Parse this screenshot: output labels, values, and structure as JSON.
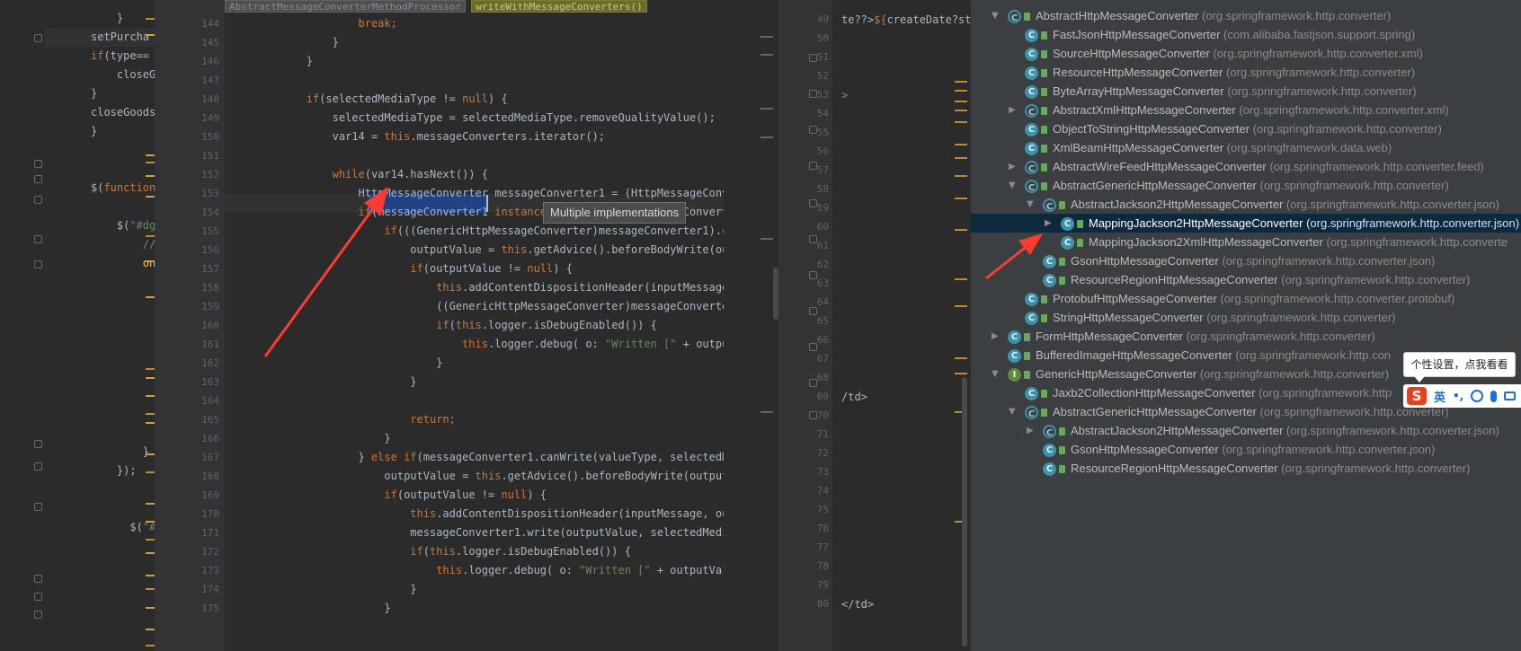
{
  "breadcrumb": [
    "AbstractMessageConverterMethodProcessor",
    "writeWithMessageConverters()"
  ],
  "tooltip": "Multiple implementations",
  "left_code": [
    {
      "parts": [
        [
          "",
          "    "
        ],
        [
          "",
          "}"
        ]
      ]
    },
    {
      "parts": [
        [
          "",
          "setPurcha"
        ]
      ]
    },
    {
      "parts": [
        [
          "kw",
          "if"
        ],
        [
          "",
          "(type=="
        ]
      ]
    },
    {
      "parts": [
        [
          "",
          "    closeG"
        ]
      ]
    },
    {
      "parts": [
        [
          "",
          "}"
        ]
      ]
    },
    {
      "parts": [
        [
          "",
          "closeGoodsC"
        ]
      ]
    },
    {
      "parts": [
        [
          "",
          "}"
        ]
      ]
    },
    {
      "parts": [
        [
          "",
          ""
        ]
      ]
    },
    {
      "parts": [
        [
          "",
          ""
        ]
      ]
    },
    {
      "parts": [
        [
          "",
          "$("
        ],
        [
          "kw",
          "function"
        ],
        [
          "",
          " ("
        ]
      ]
    },
    {
      "parts": [
        [
          "",
          ""
        ]
      ]
    },
    {
      "parts": [
        [
          "",
          "    $("
        ],
        [
          "str",
          "\"#dg\""
        ],
        [
          "",
          ").da"
        ]
      ]
    },
    {
      "parts": [
        [
          "cm",
          "        //双击事"
        ]
      ]
    },
    {
      "parts": [
        [
          "fn",
          "        onDblCl"
        ]
      ]
    },
    {
      "parts": [
        [
          "",
          "            $("
        ]
      ]
    },
    {
      "parts": [
        [
          "",
          "            $("
        ]
      ]
    },
    {
      "parts": [
        [
          "",
          "            $("
        ]
      ]
    },
    {
      "parts": [
        [
          "",
          "            $("
        ]
      ]
    },
    {
      "parts": [
        [
          "",
          "            $("
        ]
      ]
    },
    {
      "parts": [
        [
          "",
          "            $("
        ]
      ]
    },
    {
      "parts": [
        [
          "",
          "            $("
        ]
      ]
    },
    {
      "parts": [
        [
          "",
          "            $("
        ]
      ]
    },
    {
      "parts": [
        [
          "",
          "            $("
        ]
      ]
    },
    {
      "parts": [
        [
          "",
          "        }"
        ]
      ]
    },
    {
      "parts": [
        [
          "",
          "    });"
        ]
      ]
    },
    {
      "parts": [
        [
          "",
          ""
        ]
      ]
    },
    {
      "parts": [
        [
          "",
          ""
        ]
      ]
    },
    {
      "parts": [
        [
          "",
          "      $("
        ],
        [
          "str",
          "\"#dg3\""
        ],
        [
          "",
          ")."
        ]
      ]
    },
    {
      "parts": [
        [
          "cm",
          "            //双"
        ]
      ]
    },
    {
      "parts": [
        [
          "fn",
          "            onD"
        ]
      ]
    }
  ],
  "main_code": [
    {
      "num": "144",
      "parts": [
        [
          "kw",
          "                    break;"
        ]
      ]
    },
    {
      "num": "145",
      "parts": [
        [
          "",
          "                }"
        ]
      ]
    },
    {
      "num": "146",
      "parts": [
        [
          "",
          "            }"
        ]
      ]
    },
    {
      "num": "147",
      "parts": [
        [
          "",
          ""
        ]
      ]
    },
    {
      "num": "148",
      "parts": [
        [
          "kw",
          "            if"
        ],
        [
          "",
          "(selectedMediaType != "
        ],
        [
          "kw",
          "null"
        ],
        [
          "",
          ") {"
        ]
      ]
    },
    {
      "num": "149",
      "parts": [
        [
          "",
          "                selectedMediaType = selectedMediaType.removeQualityValue();"
        ]
      ]
    },
    {
      "num": "150",
      "parts": [
        [
          "",
          "                var14 = "
        ],
        [
          "kw",
          "this"
        ],
        [
          "",
          ".messageConverters.iterator();"
        ]
      ]
    },
    {
      "num": "151",
      "parts": [
        [
          "",
          ""
        ]
      ]
    },
    {
      "num": "152",
      "parts": [
        [
          "kw",
          "                while"
        ],
        [
          "",
          "(var14.hasNext()) {"
        ]
      ]
    },
    {
      "num": "153",
      "parts": [
        [
          "",
          "                    HttpMessageConverter messageConverter1 = (HttpMessageConverter)var14.next();"
        ]
      ]
    },
    {
      "num": "154",
      "parts": [
        [
          "kw",
          "                    if"
        ],
        [
          "",
          "(messageConverter1 "
        ],
        [
          "kw",
          "instanceof"
        ],
        [
          "",
          " GenericHttpMessageConverter) {"
        ]
      ]
    },
    {
      "num": "155",
      "parts": [
        [
          "kw",
          "                        if"
        ],
        [
          "",
          "(((GenericHttpMessageConverter)messageConverter1).canWrite"
        ]
      ]
    },
    {
      "num": "156",
      "parts": [
        [
          "",
          "                            outputValue = "
        ],
        [
          "kw",
          "this"
        ],
        [
          "",
          ".getAdvice().beforeBodyWrite(outputValue"
        ]
      ]
    },
    {
      "num": "157",
      "parts": [
        [
          "kw",
          "                            if"
        ],
        [
          "",
          "(outputValue != "
        ],
        [
          "kw",
          "null"
        ],
        [
          "",
          ") {"
        ]
      ]
    },
    {
      "num": "158",
      "parts": [
        [
          "kw",
          "                                this"
        ],
        [
          "",
          ".addContentDispositionHeader(inputMessage, output"
        ]
      ]
    },
    {
      "num": "159",
      "parts": [
        [
          "",
          "                                ((GenericHttpMessageConverter)messageConverter1).write"
        ]
      ]
    },
    {
      "num": "160",
      "parts": [
        [
          "kw",
          "                                if"
        ],
        [
          "",
          "("
        ],
        [
          "kw",
          "this"
        ],
        [
          "",
          ".logger.isDebugEnabled()) {"
        ]
      ]
    },
    {
      "num": "161",
      "parts": [
        [
          "kw",
          "                                    this"
        ],
        [
          "",
          ".logger.debug( o: "
        ],
        [
          "str",
          "\"Written [\""
        ],
        [
          "",
          " + outputValue"
        ]
      ]
    },
    {
      "num": "162",
      "parts": [
        [
          "",
          "                                }"
        ]
      ]
    },
    {
      "num": "163",
      "parts": [
        [
          "",
          "                            }"
        ]
      ]
    },
    {
      "num": "164",
      "parts": [
        [
          "",
          ""
        ]
      ]
    },
    {
      "num": "165",
      "parts": [
        [
          "kw",
          "                            return;"
        ]
      ]
    },
    {
      "num": "166",
      "parts": [
        [
          "",
          "                        }"
        ]
      ]
    },
    {
      "num": "167",
      "parts": [
        [
          "",
          "                    } "
        ],
        [
          "kw",
          "else if"
        ],
        [
          "",
          "(messageConverter1.canWrite(valueType, selectedMediaType"
        ]
      ]
    },
    {
      "num": "168",
      "parts": [
        [
          "",
          "                        outputValue = "
        ],
        [
          "kw",
          "this"
        ],
        [
          "",
          ".getAdvice().beforeBodyWrite(outputValue,"
        ]
      ]
    },
    {
      "num": "169",
      "parts": [
        [
          "kw",
          "                        if"
        ],
        [
          "",
          "(outputValue != "
        ],
        [
          "kw",
          "null"
        ],
        [
          "",
          ") {"
        ]
      ]
    },
    {
      "num": "170",
      "parts": [
        [
          "kw",
          "                            this"
        ],
        [
          "",
          ".addContentDispositionHeader(inputMessage, outputMe"
        ]
      ]
    },
    {
      "num": "171",
      "parts": [
        [
          "",
          "                            messageConverter1.write(outputValue, selectedMediaType,"
        ]
      ]
    },
    {
      "num": "172",
      "parts": [
        [
          "kw",
          "                            if"
        ],
        [
          "",
          "("
        ],
        [
          "kw",
          "this"
        ],
        [
          "",
          ".logger.isDebugEnabled()) {"
        ]
      ]
    },
    {
      "num": "173",
      "parts": [
        [
          "kw",
          "                                this"
        ],
        [
          "",
          ".logger.debug( o: "
        ],
        [
          "str",
          "\"Written [\""
        ],
        [
          "",
          " + outputValue + \""
        ]
      ]
    },
    {
      "num": "174",
      "parts": [
        [
          "",
          "                            }"
        ]
      ]
    },
    {
      "num": "175",
      "parts": [
        [
          "",
          "                        }"
        ]
      ]
    }
  ],
  "jsp_lines": [
    "49",
    "50",
    "51",
    "52",
    "53",
    "54",
    "55",
    "56",
    "57",
    "58",
    "59",
    "60",
    "61",
    "62",
    "63",
    "64",
    "65",
    "66",
    "67",
    "68",
    "69",
    "70",
    "71",
    "72",
    "73",
    "74",
    "75",
    "76",
    "77",
    "78",
    "79",
    "80"
  ],
  "jsp_code": {
    "0": [
      [
        "",
        "te??>"
      ],
      [
        "kw",
        "${"
      ],
      [
        "",
        "createDate?st"
      ]
    ],
    "4": [
      [
        "kw",
        ">"
      ]
    ],
    "20": [
      [
        "",
        "/td>"
      ]
    ],
    "31": [
      [
        "",
        "</td>"
      ]
    ]
  },
  "tree": [
    {
      "level": 0,
      "arrow": "down",
      "icon": "abs",
      "name": "AbstractHttpMessageConverter",
      "pkg": "(org.springframework.http.converter)"
    },
    {
      "level": 1,
      "arrow": "",
      "icon": "class",
      "name": "FastJsonHttpMessageConverter",
      "pkg": "(com.alibaba.fastjson.support.spring)"
    },
    {
      "level": 1,
      "arrow": "",
      "icon": "class",
      "name": "SourceHttpMessageConverter",
      "pkg": "(org.springframework.http.converter.xml)"
    },
    {
      "level": 1,
      "arrow": "",
      "icon": "class",
      "name": "ResourceHttpMessageConverter",
      "pkg": "(org.springframework.http.converter)"
    },
    {
      "level": 1,
      "arrow": "",
      "icon": "class",
      "name": "ByteArrayHttpMessageConverter",
      "pkg": "(org.springframework.http.converter)"
    },
    {
      "level": 1,
      "arrow": "right",
      "icon": "abs",
      "name": "AbstractXmlHttpMessageConverter",
      "pkg": "(org.springframework.http.converter.xml)"
    },
    {
      "level": 1,
      "arrow": "",
      "icon": "class",
      "name": "ObjectToStringHttpMessageConverter",
      "pkg": "(org.springframework.http.converter)"
    },
    {
      "level": 1,
      "arrow": "",
      "icon": "class",
      "name": "XmlBeamHttpMessageConverter",
      "pkg": "(org.springframework.data.web)"
    },
    {
      "level": 1,
      "arrow": "right",
      "icon": "abs",
      "name": "AbstractWireFeedHttpMessageConverter",
      "pkg": "(org.springframework.http.converter.feed)"
    },
    {
      "level": 1,
      "arrow": "down",
      "icon": "abs",
      "name": "AbstractGenericHttpMessageConverter",
      "pkg": "(org.springframework.http.converter)"
    },
    {
      "level": 2,
      "arrow": "down",
      "icon": "abs",
      "name": "AbstractJackson2HttpMessageConverter",
      "pkg": "(org.springframework.http.converter.json)"
    },
    {
      "level": 3,
      "arrow": "right",
      "icon": "class",
      "name": "MappingJackson2HttpMessageConverter",
      "pkg": "(org.springframework.http.converter.json)",
      "selected": true
    },
    {
      "level": 3,
      "arrow": "",
      "icon": "class",
      "name": "MappingJackson2XmlHttpMessageConverter",
      "pkg": "(org.springframework.http.converte"
    },
    {
      "level": 2,
      "arrow": "",
      "icon": "class",
      "name": "GsonHttpMessageConverter",
      "pkg": "(org.springframework.http.converter.json)"
    },
    {
      "level": 2,
      "arrow": "",
      "icon": "class",
      "name": "ResourceRegionHttpMessageConverter",
      "pkg": "(org.springframework.http.converter)"
    },
    {
      "level": 1,
      "arrow": "",
      "icon": "class",
      "name": "ProtobufHttpMessageConverter",
      "pkg": "(org.springframework.http.converter.protobuf)"
    },
    {
      "level": 1,
      "arrow": "",
      "icon": "class",
      "name": "StringHttpMessageConverter",
      "pkg": "(org.springframework.http.converter)"
    },
    {
      "level": 0,
      "arrow": "right",
      "icon": "class",
      "name": "FormHttpMessageConverter",
      "pkg": "(org.springframework.http.converter)"
    },
    {
      "level": 0,
      "arrow": "",
      "icon": "class",
      "name": "BufferedImageHttpMessageConverter",
      "pkg": "(org.springframework.http.con"
    },
    {
      "level": 0,
      "arrow": "down",
      "icon": "iface",
      "name": "GenericHttpMessageConverter",
      "pkg": "(org.springframework.http.converter)"
    },
    {
      "level": 1,
      "arrow": "",
      "icon": "class",
      "name": "Jaxb2CollectionHttpMessageConverter",
      "pkg": "(org.springframework.http"
    },
    {
      "level": 1,
      "arrow": "down",
      "icon": "abs",
      "name": "AbstractGenericHttpMessageConverter",
      "pkg": "(org.springframework.http.converter)"
    },
    {
      "level": 2,
      "arrow": "right",
      "icon": "abs",
      "name": "AbstractJackson2HttpMessageConverter",
      "pkg": "(org.springframework.http.converter.json)"
    },
    {
      "level": 2,
      "arrow": "",
      "icon": "class",
      "name": "GsonHttpMessageConverter",
      "pkg": "(org.springframework.http.converter.json)"
    },
    {
      "level": 2,
      "arrow": "",
      "icon": "class",
      "name": "ResourceRegionHttpMessageConverter",
      "pkg": "(org.springframework.http.converter)"
    }
  ],
  "ime": {
    "tip": "个性设置，点我看看",
    "logo": "S",
    "lang": "英",
    "punct": "•,",
    "emoji_icon": "smiley-icon",
    "mic_icon": "microphone-icon",
    "keyboard_icon": "keyboard-icon"
  },
  "colors": {
    "editor_bg": "#2b2b2b",
    "tree_bg": "#3c3f41",
    "selection": "#0d293e",
    "highlight": "#214283",
    "annotation_arrow": "#ff3b30",
    "ime_red": "#e8401c"
  }
}
